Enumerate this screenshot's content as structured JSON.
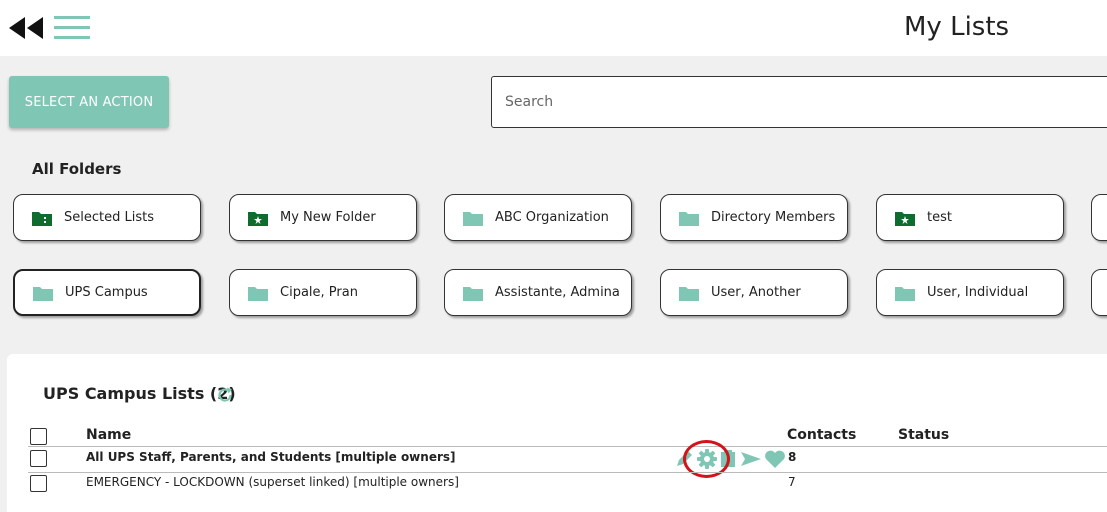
{
  "header": {
    "title": "My Lists"
  },
  "toolbar": {
    "action_label": "SELECT AN ACTION"
  },
  "search": {
    "placeholder": "Search",
    "value": ""
  },
  "folders": {
    "heading": "All Folders",
    "items": [
      {
        "label": "Selected Lists",
        "icon": "folder-selected-icon"
      },
      {
        "label": "My New Folder",
        "icon": "folder-star-icon"
      },
      {
        "label": "ABC Organization",
        "icon": "folder-icon"
      },
      {
        "label": "Directory Members",
        "icon": "folder-icon"
      },
      {
        "label": "test",
        "icon": "folder-star-icon"
      },
      {
        "label": "UPS Campus",
        "icon": "folder-icon"
      },
      {
        "label": "Cipale, Pran",
        "icon": "folder-icon"
      },
      {
        "label": "Assistante, Admina",
        "icon": "folder-icon"
      },
      {
        "label": "User, Another",
        "icon": "folder-icon"
      },
      {
        "label": "User, Individual",
        "icon": "folder-icon"
      }
    ]
  },
  "lists": {
    "title": "UPS Campus Lists (2)",
    "columns": {
      "name": "Name",
      "contacts": "Contacts",
      "status": "Status"
    },
    "rows": [
      {
        "name": "All UPS Staff, Parents, and Students [multiple owners]",
        "contacts": "8",
        "status": ""
      },
      {
        "name": "EMERGENCY - LOCKDOWN (superset linked) [multiple owners]",
        "contacts": "7",
        "status": ""
      }
    ]
  },
  "colors": {
    "accent": "#7fc7b4",
    "folder_dark": "#0f6b2e",
    "highlight": "#d3121b"
  }
}
